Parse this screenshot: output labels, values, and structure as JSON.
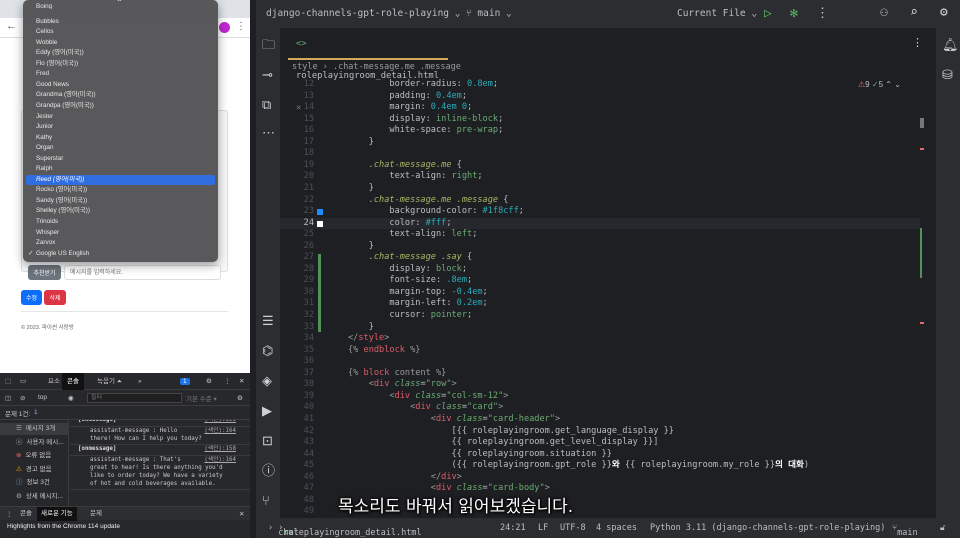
{
  "browser": {
    "page": {
      "buttons": {
        "recommend": "추천받기",
        "edit": "수정",
        "delete": "삭제"
      },
      "message_placeholder": "메시지를 입력하세요.",
      "footer": "© 2023. 파이썬 사랑방"
    },
    "voice_menu": {
      "items": [
        "Boing",
        "Bubbles",
        "Cellos",
        "Wobble",
        "Eddy (영어(미국))",
        "Flo (영어(미국))",
        "Fred",
        "Good News",
        "Grandma (영어(미국))",
        "Grandpa (영어(미국))",
        "Jester",
        "Junior",
        "Kathy",
        "Organ",
        "Superstar",
        "Ralph",
        "Reed (영어(미국))",
        "Rocko (영어(미국))",
        "Sandy (영어(미국))",
        "Shelley (영어(미국))",
        "Trinoids",
        "Whisper",
        "Zarvox",
        "Google US English"
      ],
      "highlighted": "Reed (영어(미국))",
      "checked": "Google US English"
    }
  },
  "devtools": {
    "tabs": [
      "요소",
      "콘솔",
      "녹음기 ⏶",
      "»"
    ],
    "active_tab": "콘솔",
    "issue_badge": "1",
    "context": "top",
    "filter_placeholder": "필터",
    "level": "기본 수준 ▾",
    "issues": "문제 1건:",
    "issues_count": "1",
    "sidebar": [
      "메시지 3개",
      "사용자 메시...",
      "오류 없음",
      "경고 없음",
      "정보 3건",
      "상세 메시지..."
    ],
    "logs": [
      {
        "label": "[onmessage]",
        "src": "(색인):158"
      },
      {
        "text": "assistant-message : Hello\nthere! How can I help you today?",
        "src": "(색인):164"
      },
      {
        "label": "[onmessage]",
        "src": "(색인):158"
      },
      {
        "text": "assistant-message : That's\ngreat to hear! Is there anything you'd\nlike to order today? We have a variety\nof hot and cold beverages available.",
        "src": "(색인):164"
      }
    ],
    "drawer_tabs": [
      "콘솔",
      "새로운 기능",
      "문제"
    ],
    "drawer_text": "Highlights from the Chrome 114 update"
  },
  "ide": {
    "project": "django-channels-gpt-role-playing",
    "branch": "main",
    "run_config": "Current File",
    "file_tab": "roleplayingroom_detail.html",
    "breadcrumb": [
      "style",
      ".chat-message.me .message"
    ],
    "warnings": "9",
    "ok": "5",
    "code": [
      [
        12,
        [
          [
            "        border-radius",
            "k"
          ],
          [
            ": ",
            "p"
          ],
          [
            "0.8em",
            "n"
          ],
          [
            ";",
            "p"
          ]
        ]
      ],
      [
        13,
        [
          [
            "        padding",
            "k"
          ],
          [
            ": ",
            "p"
          ],
          [
            "0.4em",
            "n"
          ],
          [
            ";",
            "p"
          ]
        ]
      ],
      [
        14,
        [
          [
            "        margin",
            "k"
          ],
          [
            ": ",
            "p"
          ],
          [
            "0.4em 0",
            "n"
          ],
          [
            ";",
            "p"
          ]
        ]
      ],
      [
        15,
        [
          [
            "        display",
            "k"
          ],
          [
            ": ",
            "p"
          ],
          [
            "inline-block",
            "v"
          ],
          [
            ";",
            "p"
          ]
        ]
      ],
      [
        16,
        [
          [
            "        white-space",
            "k"
          ],
          [
            ": ",
            "p"
          ],
          [
            "pre-wrap",
            "v"
          ],
          [
            ";",
            "p"
          ]
        ]
      ],
      [
        17,
        [
          [
            "    }",
            "p"
          ]
        ]
      ],
      [
        18,
        []
      ],
      [
        19,
        [
          [
            "    .chat-message.me",
            "sel"
          ],
          [
            " {",
            "p"
          ]
        ]
      ],
      [
        20,
        [
          [
            "        text-align",
            "k"
          ],
          [
            ": ",
            "p"
          ],
          [
            "right",
            "v"
          ],
          [
            ";",
            "p"
          ]
        ]
      ],
      [
        21,
        [
          [
            "    }",
            "p"
          ]
        ]
      ],
      [
        22,
        [
          [
            "    .chat-message.me .message",
            "sel"
          ],
          [
            " {",
            "p"
          ]
        ]
      ],
      [
        23,
        [
          [
            "        background-color",
            "k"
          ],
          [
            ": ",
            "p"
          ],
          [
            "#1f8cff",
            "n"
          ],
          [
            ";",
            "p"
          ]
        ]
      ],
      [
        24,
        [
          [
            "        color",
            "k"
          ],
          [
            ": ",
            "p"
          ],
          [
            "#fff",
            "n"
          ],
          [
            ";",
            "p"
          ]
        ]
      ],
      [
        25,
        [
          [
            "        text-align",
            "k"
          ],
          [
            ": ",
            "p"
          ],
          [
            "left",
            "v"
          ],
          [
            ";",
            "p"
          ]
        ]
      ],
      [
        26,
        [
          [
            "    }",
            "p"
          ]
        ]
      ],
      [
        27,
        [
          [
            "    .chat-message .say",
            "sel"
          ],
          [
            " {",
            "p"
          ]
        ]
      ],
      [
        28,
        [
          [
            "        display",
            "k"
          ],
          [
            ": ",
            "p"
          ],
          [
            "block",
            "v"
          ],
          [
            ";",
            "p"
          ]
        ]
      ],
      [
        29,
        [
          [
            "        font-size",
            "k"
          ],
          [
            ": ",
            "p"
          ],
          [
            ".8em",
            "n"
          ],
          [
            ";",
            "p"
          ]
        ]
      ],
      [
        30,
        [
          [
            "        margin-top",
            "k"
          ],
          [
            ": ",
            "p"
          ],
          [
            "-0.4em",
            "n"
          ],
          [
            ";",
            "p"
          ]
        ]
      ],
      [
        31,
        [
          [
            "        margin-left",
            "k"
          ],
          [
            ": ",
            "p"
          ],
          [
            "0.2em",
            "n"
          ],
          [
            ";",
            "p"
          ]
        ]
      ],
      [
        32,
        [
          [
            "        cursor",
            "k"
          ],
          [
            ": ",
            "p"
          ],
          [
            "pointer",
            "v"
          ],
          [
            ";",
            "p"
          ]
        ]
      ],
      [
        33,
        [
          [
            "    }",
            "p"
          ]
        ]
      ],
      [
        34,
        [
          [
            "</",
            "gr"
          ],
          [
            "style",
            "dj"
          ],
          [
            ">",
            "gr"
          ]
        ]
      ],
      [
        35,
        [
          [
            "{% ",
            "gr"
          ],
          [
            "endblock",
            "dj"
          ],
          [
            " %}",
            "gr"
          ]
        ]
      ],
      [
        36,
        []
      ],
      [
        37,
        [
          [
            "{% ",
            "gr"
          ],
          [
            "block",
            "dj"
          ],
          [
            " content %}",
            "gr"
          ]
        ]
      ],
      [
        38,
        [
          [
            "    <",
            "gr"
          ],
          [
            "div ",
            "dj"
          ],
          [
            "class",
            "attr"
          ],
          [
            "=",
            "p"
          ],
          [
            "\"row\"",
            "str"
          ],
          [
            ">",
            "gr"
          ]
        ]
      ],
      [
        39,
        [
          [
            "        <",
            "gr"
          ],
          [
            "div ",
            "dj"
          ],
          [
            "class",
            "attr"
          ],
          [
            "=",
            "p"
          ],
          [
            "\"col-sm-12\"",
            "str"
          ],
          [
            ">",
            "gr"
          ]
        ]
      ],
      [
        40,
        [
          [
            "            <",
            "gr"
          ],
          [
            "div ",
            "dj"
          ],
          [
            "class",
            "attr"
          ],
          [
            "=",
            "p"
          ],
          [
            "\"card\"",
            "str"
          ],
          [
            ">",
            "gr"
          ]
        ]
      ],
      [
        41,
        [
          [
            "                <",
            "gr"
          ],
          [
            "div ",
            "dj"
          ],
          [
            "class",
            "attr"
          ],
          [
            "=",
            "p"
          ],
          [
            "\"card-header\"",
            "str"
          ],
          [
            ">",
            "gr"
          ]
        ]
      ],
      [
        42,
        [
          [
            "                    [{{ roleplayingroom.get_language_display }}",
            "p"
          ]
        ]
      ],
      [
        43,
        [
          [
            "                    {{ roleplayingroom.get_level_display }}]",
            "p"
          ]
        ]
      ],
      [
        44,
        [
          [
            "                    {{ roleplayingroom.situation }}",
            "p"
          ]
        ]
      ],
      [
        45,
        [
          [
            "                    ({{ roleplayingroom.gpt_role }}",
            "p"
          ],
          [
            "와 ",
            "wh"
          ],
          [
            "{{ roleplayingroom.my_role }}",
            "p"
          ],
          [
            "의 대화",
            "wh"
          ],
          [
            ")",
            "p"
          ]
        ]
      ],
      [
        46,
        [
          [
            "                </",
            "gr"
          ],
          [
            "div",
            "dj"
          ],
          [
            ">",
            "gr"
          ]
        ]
      ],
      [
        47,
        [
          [
            "                <",
            "gr"
          ],
          [
            "div ",
            "dj"
          ],
          [
            "class",
            "attr"
          ],
          [
            "=",
            "p"
          ],
          [
            "\"card-body\"",
            "str"
          ],
          [
            ">",
            "gr"
          ]
        ]
      ],
      [
        48,
        []
      ],
      [
        49,
        []
      ]
    ],
    "status": {
      "path": [
        "chat",
        "roleplayingroom_detail.html"
      ],
      "position": "24:21",
      "eol": "LF",
      "encoding": "UTF-8",
      "indent": "4 spaces",
      "interpreter": "Python 3.11 (django-channels-gpt-role-playing)",
      "branch": "main"
    }
  },
  "subtitle": "목소리도 바꿔서 읽어보겠습니다."
}
